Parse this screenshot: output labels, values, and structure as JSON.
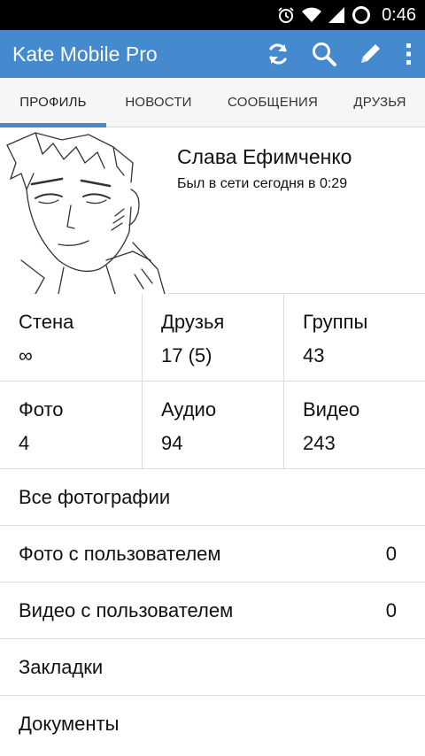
{
  "status_bar": {
    "time": "0:46"
  },
  "app_bar": {
    "title": "Kate Mobile Pro",
    "accent_color": "#4589cf",
    "actions": [
      "refresh-icon",
      "search-icon",
      "pencil-icon",
      "more-vert-icon"
    ]
  },
  "tabs": [
    {
      "label": "ПРОФИЛЬ",
      "active": true
    },
    {
      "label": "НОВОСТИ",
      "active": false
    },
    {
      "label": "СООБЩЕНИЯ",
      "active": false
    },
    {
      "label": "ДРУЗЬЯ",
      "active": false
    }
  ],
  "profile": {
    "name": "Слава Ефимченко",
    "status": "Был в сети сегодня в 0:29"
  },
  "stats": [
    {
      "label": "Стена",
      "value": "∞"
    },
    {
      "label": "Друзья",
      "value": "17 (5)"
    },
    {
      "label": "Группы",
      "value": "43"
    },
    {
      "label": "Фото",
      "value": "4"
    },
    {
      "label": "Аудио",
      "value": "94"
    },
    {
      "label": "Видео",
      "value": "243"
    }
  ],
  "menu": [
    {
      "label": "Все фотографии",
      "count": ""
    },
    {
      "label": "Фото с пользователем",
      "count": "0"
    },
    {
      "label": "Видео с пользователем",
      "count": "0"
    },
    {
      "label": "Закладки",
      "count": ""
    },
    {
      "label": "Документы",
      "count": ""
    }
  ]
}
